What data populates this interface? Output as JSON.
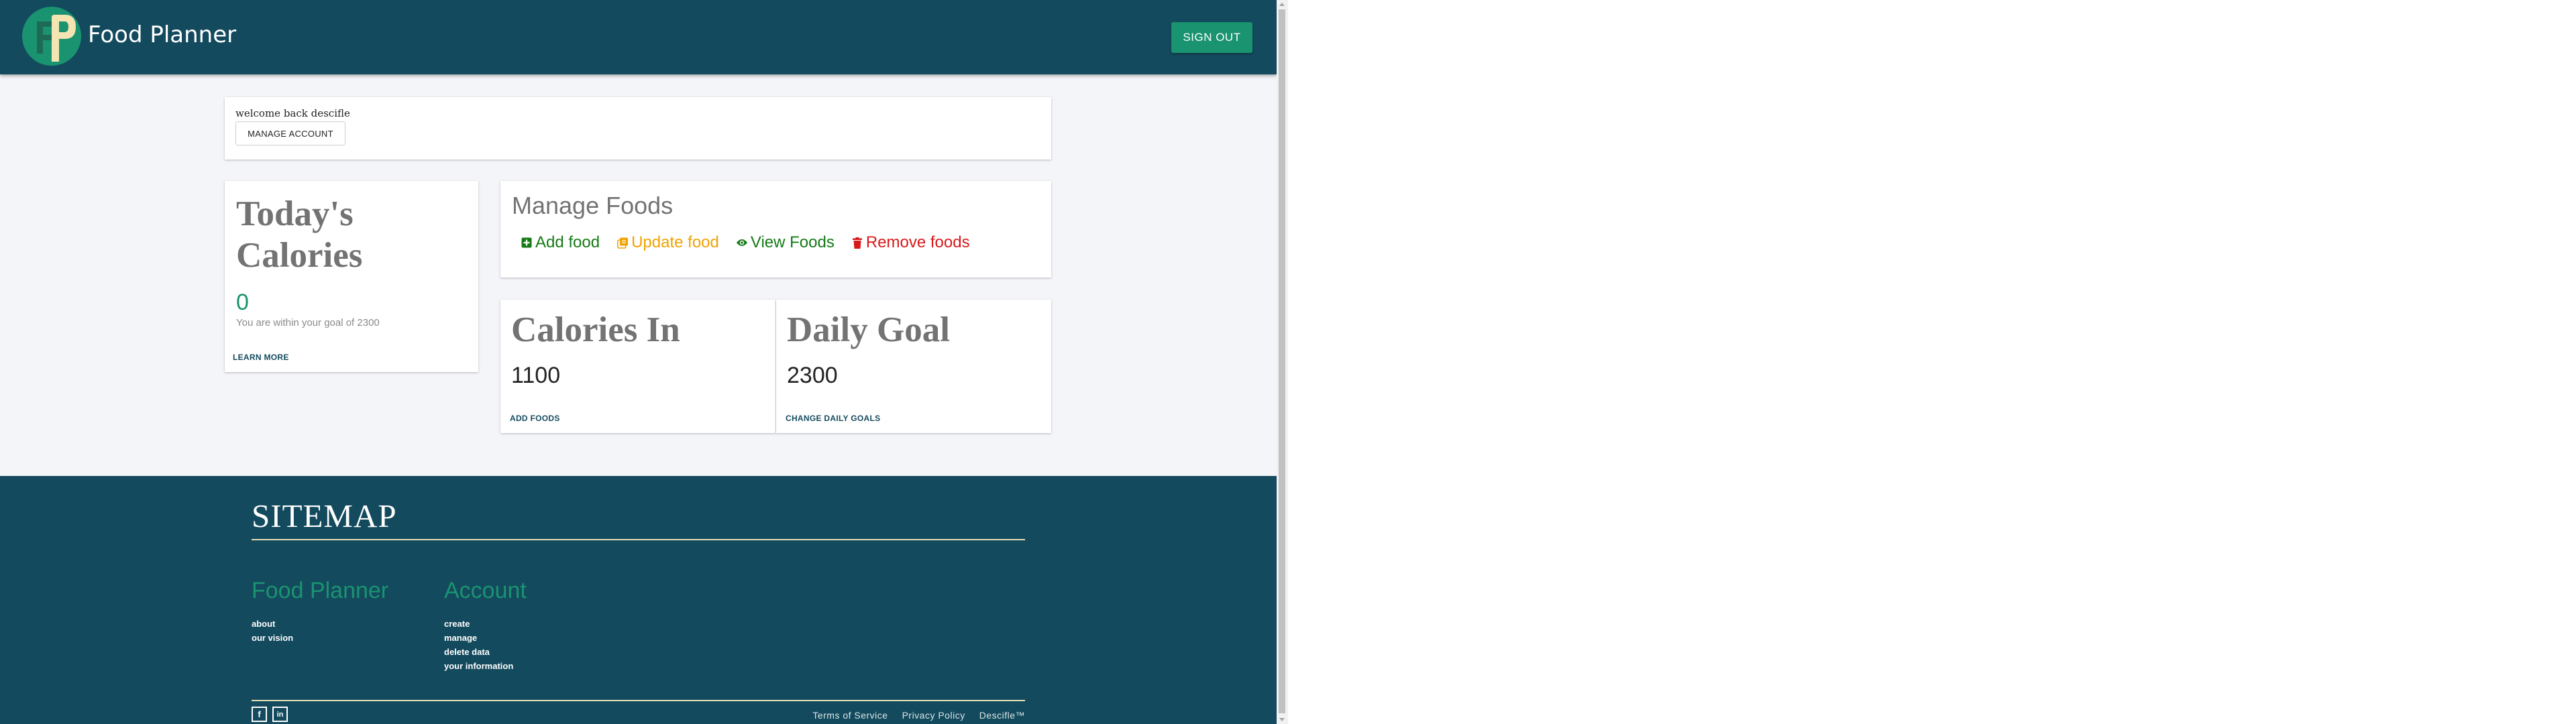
{
  "header": {
    "brand": "Food Planner",
    "signout_label": "SIGN OUT"
  },
  "welcome": {
    "text": "welcome back descifle",
    "manage_label": "MANAGE ACCOUNT"
  },
  "today": {
    "title": "Today's Calories",
    "value": "0",
    "note": "You are within your goal of 2300",
    "link": "LEARN MORE"
  },
  "manage_foods": {
    "title": "Manage Foods",
    "actions": [
      {
        "label": "Add food",
        "icon": "plus-square-icon",
        "color": "#147a14"
      },
      {
        "label": "Update food",
        "icon": "copy-icon",
        "color": "#f0a202"
      },
      {
        "label": "View Foods",
        "icon": "eye-icon",
        "color": "#147a14"
      },
      {
        "label": "Remove foods",
        "icon": "trash-icon",
        "color": "#d61a1a"
      }
    ]
  },
  "calories_in": {
    "title": "Calories In",
    "value": "1100",
    "link": "ADD FOODS"
  },
  "daily_goal": {
    "title": "Daily Goal",
    "value": "2300",
    "link": "CHANGE DAILY GOALS"
  },
  "footer": {
    "title": "SITEMAP",
    "columns": [
      {
        "heading": "Food Planner",
        "links": [
          "about",
          "our vision"
        ]
      },
      {
        "heading": "Account",
        "links": [
          "create",
          "manage",
          "delete data",
          "your information"
        ]
      }
    ],
    "social": [
      {
        "icon": "facebook-icon",
        "glyph": "f"
      },
      {
        "icon": "linkedin-icon",
        "glyph": "in"
      }
    ],
    "links": [
      "Terms of Service",
      "Privacy Policy",
      "Descifle™"
    ]
  },
  "colors": {
    "header": "#134a5d",
    "accent": "#1a9370",
    "background": "#f4f5f9"
  }
}
